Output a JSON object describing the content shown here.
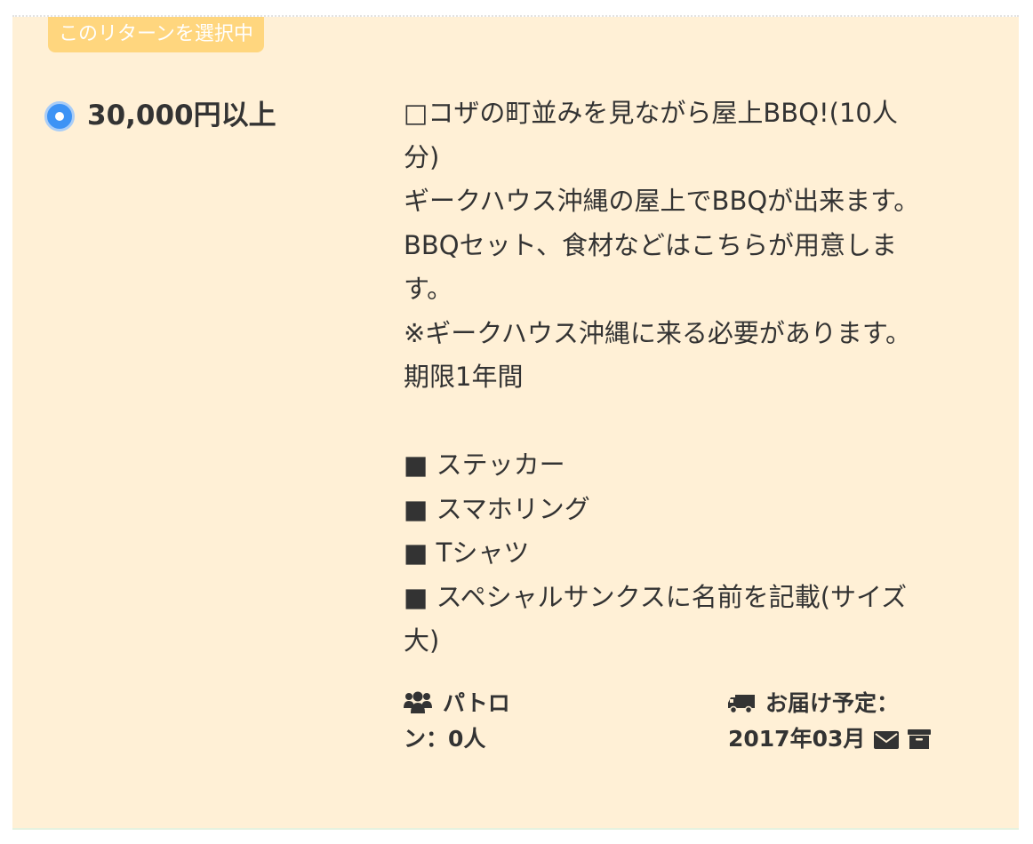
{
  "reward": {
    "badge_label": "このリターンを選択中",
    "price_label": "30,000円以上",
    "description_lines": [
      "□コザの町並みを見ながら屋上BBQ!(10人",
      "分)",
      "ギークハウス沖縄の屋上でBBQが出来ます。",
      "BBQセット、食材などはこちらが用意しま",
      "す。",
      "※ギークハウス沖縄に来る必要があります。",
      "期限1年間"
    ],
    "items": [
      "■ ステッカー",
      "■ スマホリング",
      "■ Tシャツ",
      "■ スペシャルサンクスに名前を記載(サイズ",
      "大)"
    ],
    "patron_label_line1": "パトロ",
    "patron_label_line2": "ン：0人",
    "delivery_label": "お届け予定：",
    "delivery_value": "2017年03月"
  },
  "icons": {
    "radio": "radio-selected-icon",
    "patron": "users-icon",
    "delivery": "truck-icon",
    "mail": "envelope-icon",
    "box": "archive-box-icon"
  },
  "colors": {
    "card_background": "#fff0d6",
    "badge_background": "#ffd67e",
    "radio_selected": "#3d93f5",
    "text": "#333333"
  }
}
